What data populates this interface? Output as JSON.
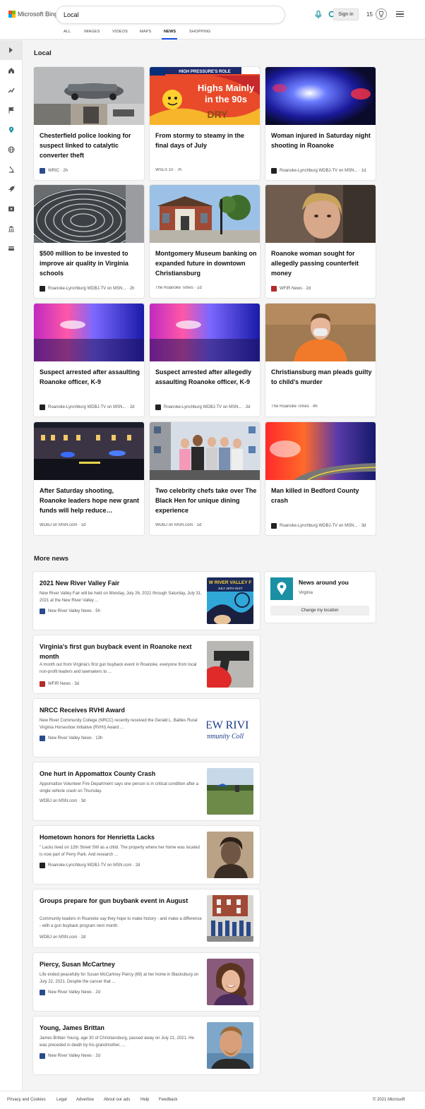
{
  "header": {
    "logo_text": "Microsoft Bing",
    "search_value": "Local",
    "sign_in": "Sign in",
    "points": "15"
  },
  "nav": [
    "ALL",
    "IMAGES",
    "VIDEOS",
    "MAPS",
    "NEWS",
    "SHOPPING"
  ],
  "local": {
    "title": "Local",
    "cards": [
      {
        "title": "Chesterfield police looking for suspect linked to catalytic converter theft",
        "source": "WRIC",
        "age": "2h"
      },
      {
        "title": "From stormy to steamy in the final days of July",
        "source": "WSLS 10",
        "age": "7h"
      },
      {
        "title": "Woman injured in Saturday night shooting in Roanoke",
        "source": "Roanoke-Lynchburg WDBJ-TV on MSN...",
        "age": "1d"
      },
      {
        "title": "$500 million to be invested to improve air quality in Virginia schools",
        "source": "Roanoke-Lynchburg WDBJ-TV on MSN...",
        "age": "2h"
      },
      {
        "title": "Montgomery Museum banking on expanded future in downtown Christiansburg",
        "source": "The Roanoke Times",
        "age": "1d"
      },
      {
        "title": "Roanoke woman sought for allegedly passing counterfeit money",
        "source": "WFIR News",
        "age": "2d"
      },
      {
        "title": "Suspect arrested after assaulting Roanoke officer, K-9",
        "source": "Roanoke-Lynchburg WDBJ-TV on MSN...",
        "age": "2d"
      },
      {
        "title": "Suspect arrested after allegedly assaulting Roanoke officer, K-9",
        "source": "Roanoke-Lynchburg WDBJ-TV on MSN...",
        "age": "2d"
      },
      {
        "title": "Christiansburg man pleads guilty to child's murder",
        "source": "The Roanoke Times",
        "age": "4h"
      },
      {
        "title": "After Saturday shooting, Roanoke leaders hope new grant funds will help reduce…",
        "source": "WDBJ on MSN.com",
        "age": "1d"
      },
      {
        "title": "Two celebrity chefs take over The Black Hen for unique dining experience",
        "source": "WDBJ on MSN.com",
        "age": "1d"
      },
      {
        "title": "Man killed in Bedford County crash",
        "source": "Roanoke-Lynchburg WDBJ-TV on MSN...",
        "age": "3d"
      }
    ],
    "weather_thumb": {
      "banner": "HIGH PRESSURE'S ROLE",
      "text1": "Highs Mainly",
      "text2": "in the 90s",
      "text3": "DRY"
    }
  },
  "more_news": {
    "title": "More news",
    "items": [
      {
        "title": "2021 New River Valley Fair",
        "snippet": "New River Valley Fair will be held on Monday, July 26, 2021 through Saturday, July 31, 2021 at the New River Valley ...",
        "source": "New River Valley News",
        "age": "5h",
        "thumb_text1": "W RIVER VALLEY F",
        "thumb_text2": "JULY 26TH-31ST"
      },
      {
        "title": "Virginia's first gun buyback event in Roanoke next month",
        "snippet": "A month out from Virginia's first gun buyback event in Roanoke, everyone from local non-profit leaders and lawmakers to ...",
        "source": "WFIR News",
        "age": "3d"
      },
      {
        "title": "NRCC Receives RVHI Award",
        "snippet": "New River Community College (NRCC) recently received the Gerald L. Baliles Rural Virginia Horseshoe Initiative (RVHI) Award ...",
        "source": "New River Valley News",
        "age": "13h",
        "thumb_text1": "EW RIVI",
        "thumb_text2": "mmunity Coll"
      },
      {
        "title": "One hurt in Appomattox County Crash",
        "snippet": "Appomattox Volunteer Fire Department says one person is in critical condition after a single vehicle crash on Thursday.",
        "source": "WDBJ on MSN.com",
        "age": "3d"
      },
      {
        "title": "Hometown honors for Henrietta Lacks",
        "snippet": "\" Lacks lived on 12th Street SW as a child. The property where her home was located is now part of Perry Park. And research ...",
        "source": "Roanoke-Lynchburg WDBJ-TV on MSN.com",
        "age": "2d"
      },
      {
        "title": "Groups prepare for gun buybank event in August",
        "snippet": "Community leaders in Roanoke say they hope to make history - and make a difference - with a gun buyback program next month.",
        "source": "WDBJ on MSN.com",
        "age": "2d"
      },
      {
        "title": "Piercy, Susan McCartney",
        "snippet": "Life ended peacefully for Susan McCartney Piercy (69) at her home in Blacksburg on July 22, 2021. Despite the cancer that ...",
        "source": "New River Valley News",
        "age": "2d"
      },
      {
        "title": "Young, James Brittan",
        "snippet": "James Brittan Young, age 30 of Christiansburg, passed away on July 21, 2021. He was preceded in death by his grandmother, ...",
        "source": "New River Valley News",
        "age": "2d"
      }
    ]
  },
  "news_around_you": {
    "title": "News around you",
    "location": "Virginia",
    "button": "Change my location"
  },
  "footer": {
    "links": [
      "Privacy and Cookies",
      "Legal",
      "Advertise",
      "About our ads",
      "Help",
      "Feedback"
    ],
    "copyright": "© 2021 Microsoft"
  },
  "colors": {
    "accent": "#174ae4",
    "teal": "#1b8fa3",
    "page_bg": "#f4f4f4"
  }
}
